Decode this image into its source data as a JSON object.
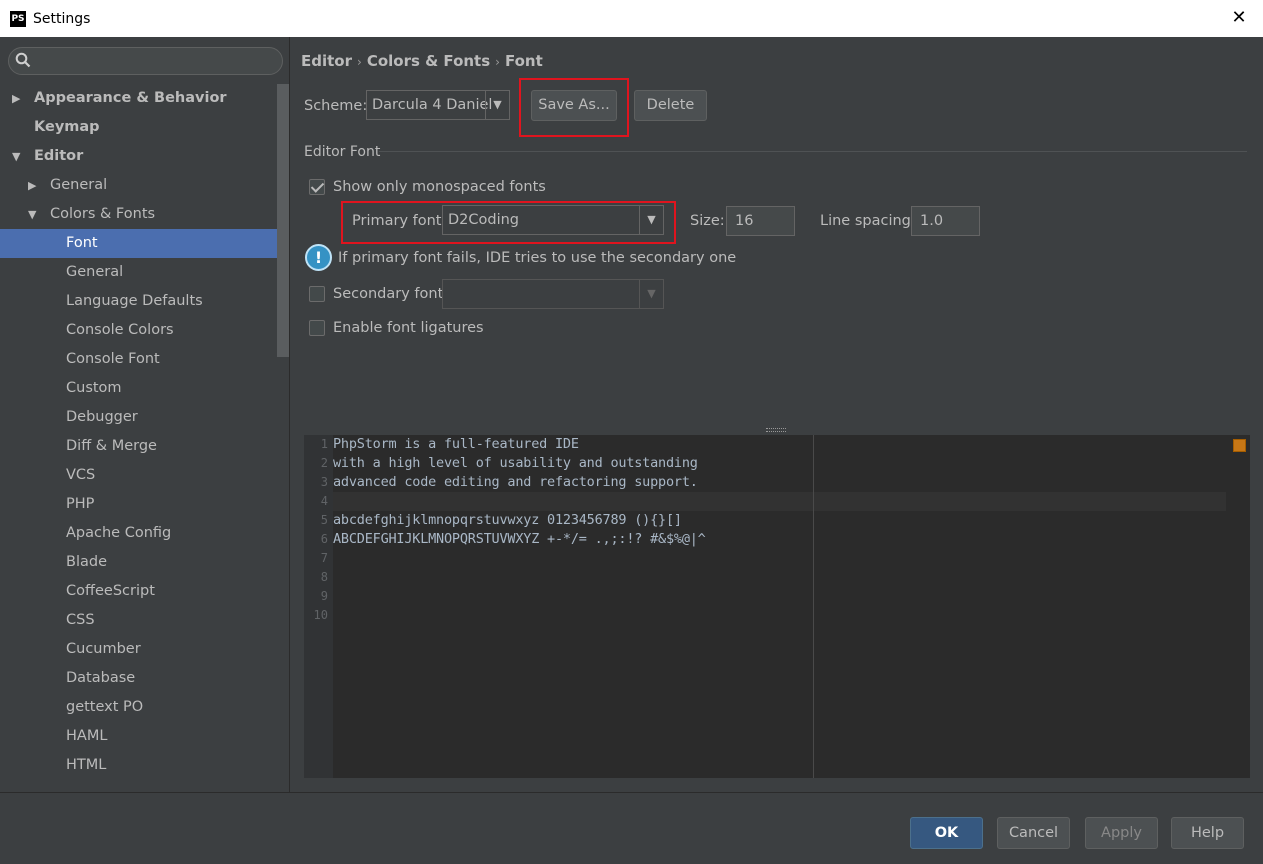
{
  "window": {
    "title": "Settings",
    "logo": "PS"
  },
  "search": {
    "placeholder": ""
  },
  "sidebar": {
    "items": [
      {
        "label": "Appearance & Behavior",
        "bold": true,
        "arrow": "right",
        "level": 0
      },
      {
        "label": "Keymap",
        "bold": true,
        "arrow": "none",
        "level": 0
      },
      {
        "label": "Editor",
        "bold": true,
        "arrow": "down",
        "level": 0
      },
      {
        "label": "General",
        "bold": false,
        "arrow": "right",
        "level": 1
      },
      {
        "label": "Colors & Fonts",
        "bold": false,
        "arrow": "down",
        "level": 1
      },
      {
        "label": "Font",
        "bold": false,
        "arrow": "none",
        "level": 2,
        "selected": true
      },
      {
        "label": "General",
        "bold": false,
        "arrow": "none",
        "level": 2
      },
      {
        "label": "Language Defaults",
        "bold": false,
        "arrow": "none",
        "level": 2
      },
      {
        "label": "Console Colors",
        "bold": false,
        "arrow": "none",
        "level": 2
      },
      {
        "label": "Console Font",
        "bold": false,
        "arrow": "none",
        "level": 2
      },
      {
        "label": "Custom",
        "bold": false,
        "arrow": "none",
        "level": 2
      },
      {
        "label": "Debugger",
        "bold": false,
        "arrow": "none",
        "level": 2
      },
      {
        "label": "Diff & Merge",
        "bold": false,
        "arrow": "none",
        "level": 2
      },
      {
        "label": "VCS",
        "bold": false,
        "arrow": "none",
        "level": 2
      },
      {
        "label": "PHP",
        "bold": false,
        "arrow": "none",
        "level": 2
      },
      {
        "label": "Apache Config",
        "bold": false,
        "arrow": "none",
        "level": 2
      },
      {
        "label": "Blade",
        "bold": false,
        "arrow": "none",
        "level": 2
      },
      {
        "label": "CoffeeScript",
        "bold": false,
        "arrow": "none",
        "level": 2
      },
      {
        "label": "CSS",
        "bold": false,
        "arrow": "none",
        "level": 2
      },
      {
        "label": "Cucumber",
        "bold": false,
        "arrow": "none",
        "level": 2
      },
      {
        "label": "Database",
        "bold": false,
        "arrow": "none",
        "level": 2
      },
      {
        "label": "gettext PO",
        "bold": false,
        "arrow": "none",
        "level": 2
      },
      {
        "label": "HAML",
        "bold": false,
        "arrow": "none",
        "level": 2
      },
      {
        "label": "HTML",
        "bold": false,
        "arrow": "none",
        "level": 2
      }
    ]
  },
  "breadcrumb": [
    "Editor",
    "Colors & Fonts",
    "Font"
  ],
  "scheme": {
    "label": "Scheme:",
    "value": "Darcula 4 Daniel",
    "save_as": "Save As...",
    "delete": "Delete"
  },
  "editor_font": {
    "section_title": "Editor Font",
    "mono_only": {
      "label": "Show only monospaced fonts",
      "checked": true
    },
    "primary_label": "Primary font:",
    "primary_value": "D2Coding",
    "size_label": "Size:",
    "size_value": "16",
    "spacing_label": "Line spacing:",
    "spacing_value": "1.0",
    "info_text": "If primary font fails, IDE tries to use the secondary one",
    "secondary": {
      "label": "Secondary font:",
      "checked": false,
      "value": ""
    },
    "ligatures": {
      "label": "Enable font ligatures",
      "checked": false
    }
  },
  "preview": {
    "line_numbers": [
      "1",
      "2",
      "3",
      "4",
      "5",
      "6",
      "7",
      "8",
      "9",
      "10"
    ],
    "lines": [
      "PhpStorm is a full-featured IDE",
      "with a high level of usability and outstanding",
      "advanced code editing and refactoring support.",
      "",
      "abcdefghijklmnopqrstuvwxyz 0123456789 (){}[]",
      "ABCDEFGHIJKLMNOPQRSTUVWXYZ +-*/= .,;:!? #&$%@|^",
      "",
      "",
      "",
      ""
    ]
  },
  "footer": {
    "ok": "OK",
    "cancel": "Cancel",
    "apply": "Apply",
    "help": "Help"
  },
  "colors": {
    "accent": "#4b6eaf",
    "highlight_box": "#e0141e",
    "bg": "#3c3f41",
    "editor_bg": "#2b2b2b"
  }
}
